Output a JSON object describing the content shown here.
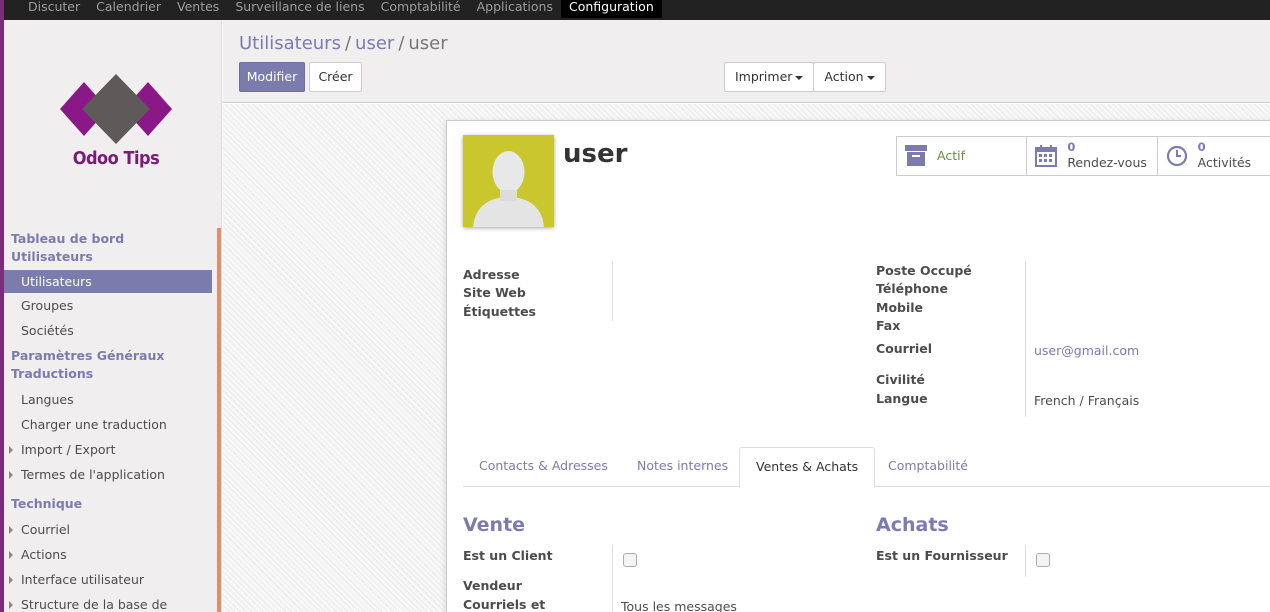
{
  "topnav": {
    "items": [
      "Discuter",
      "Calendrier",
      "Ventes",
      "Surveillance de liens",
      "Comptabilité",
      "Applications",
      "Configuration"
    ],
    "active": "Configuration"
  },
  "logo": {
    "text": "Odoo Tips"
  },
  "sidebar": {
    "sections": [
      {
        "title": "Tableau de bord",
        "items": []
      },
      {
        "title": "Utilisateurs",
        "items": [
          "Utilisateurs",
          "Groupes",
          "Sociétés"
        ]
      },
      {
        "title": "Paramètres Généraux",
        "items": []
      },
      {
        "title": "Traductions",
        "items": [
          "Langues",
          "Charger une traduction",
          "Import / Export",
          "Termes de l'application"
        ]
      },
      {
        "title": "Technique",
        "items": [
          "Courriel",
          "Actions",
          "Interface utilisateur",
          "Structure de la base de"
        ]
      }
    ],
    "active_item": "Utilisateurs"
  },
  "breadcrumb": {
    "level1": "Utilisateurs",
    "level2": "user",
    "current": "user",
    "sep": "/"
  },
  "buttons": {
    "edit": "Modifier",
    "create": "Créer",
    "print": "Imprimer",
    "action": "Action"
  },
  "record": {
    "name": "user"
  },
  "smart_buttons": {
    "active": "Actif",
    "meetings_count": "0",
    "meetings_label": "Rendez-vous",
    "activities_count": "0",
    "activities_label": "Activités"
  },
  "fields_left": {
    "address": "Adresse",
    "website": "Site Web",
    "tags": "Étiquettes"
  },
  "fields_right": {
    "function": "Poste Occupé",
    "phone": "Téléphone",
    "mobile": "Mobile",
    "fax": "Fax",
    "email_label": "Courriel",
    "email_value": "user@gmail.com",
    "title": "Civilité",
    "lang_label": "Langue",
    "lang_value": "French / Français"
  },
  "tabs": [
    "Contacts & Adresses",
    "Notes internes",
    "Ventes & Achats",
    "Comptabilité"
  ],
  "active_tab": "Ventes & Achats",
  "sales": {
    "title": "Vente",
    "is_customer": "Est un Client",
    "salesperson": "Vendeur",
    "emails": "Courriels et",
    "emails_value": "Tous les messages"
  },
  "purchases": {
    "title": "Achats",
    "is_supplier": "Est un Fournisseur"
  },
  "colors": {
    "brand": "#7c7bad",
    "logo": "#7c1a78",
    "scrollbar": "#e58d6a",
    "active_green": "#6c8b3c"
  }
}
